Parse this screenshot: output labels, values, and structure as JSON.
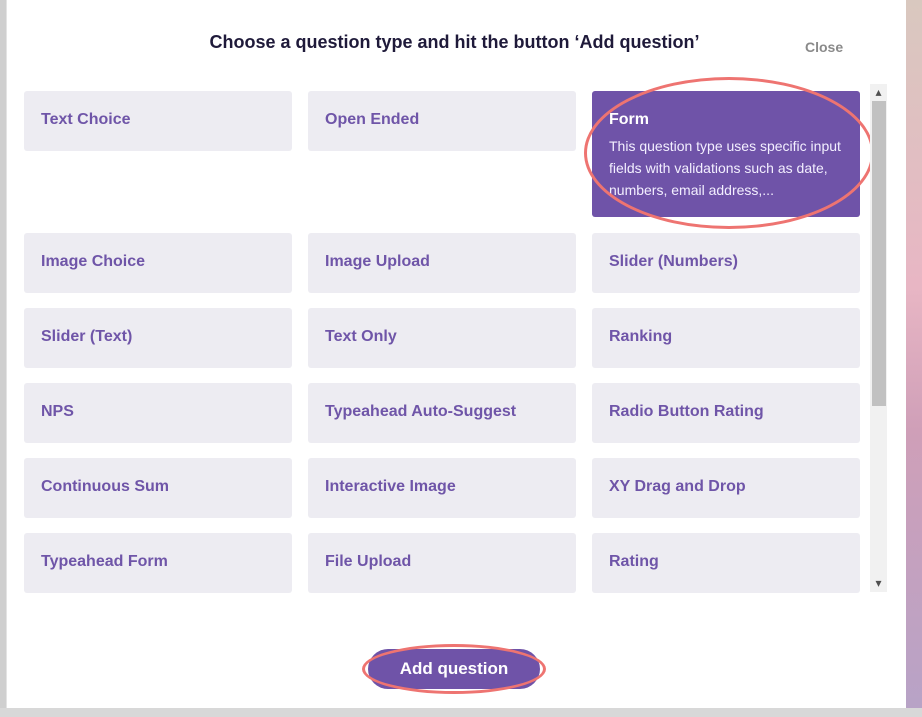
{
  "dialog": {
    "title": "Choose a question type and hit the button ‘Add question’",
    "close_label": "Close",
    "add_button_label": "Add question"
  },
  "question_types": [
    {
      "label": "Text Choice"
    },
    {
      "label": "Open Ended"
    },
    {
      "label": "Form",
      "description": "This question type uses specific input fields with validations such as date, numbers, email address,...",
      "selected": true
    },
    {
      "label": "Image Choice"
    },
    {
      "label": "Image Upload"
    },
    {
      "label": "Slider (Numbers)"
    },
    {
      "label": "Slider (Text)"
    },
    {
      "label": "Text Only"
    },
    {
      "label": "Ranking"
    },
    {
      "label": "NPS"
    },
    {
      "label": "Typeahead Auto-Suggest"
    },
    {
      "label": "Radio Button Rating"
    },
    {
      "label": "Continuous Sum"
    },
    {
      "label": "Interactive Image"
    },
    {
      "label": "XY Drag and Drop"
    },
    {
      "label": "Typeahead Form"
    },
    {
      "label": "File Upload"
    },
    {
      "label": "Rating"
    }
  ],
  "icons": {
    "scroll_up": "chevron-up-icon",
    "scroll_down": "chevron-down-icon"
  },
  "colors": {
    "accent": "#6f53a8",
    "card_bg": "#edecf2",
    "highlight": "#ee7471"
  }
}
